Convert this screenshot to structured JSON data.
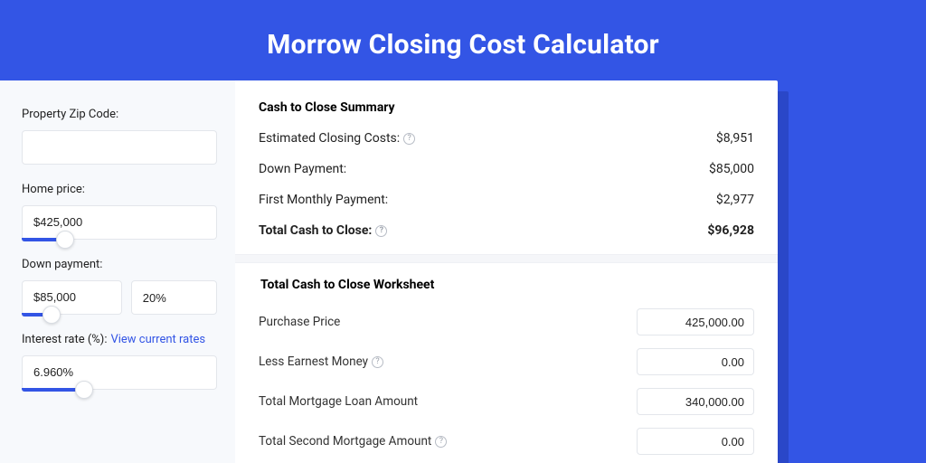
{
  "title": "Morrow Closing Cost Calculator",
  "left": {
    "zip": {
      "label": "Property Zip Code:",
      "value": ""
    },
    "home_price": {
      "label": "Home price:",
      "value": "$425,000",
      "slider_pct": 22
    },
    "down_payment": {
      "label": "Down payment:",
      "value": "$85,000",
      "pct_value": "20%",
      "slider_pct": 30
    },
    "interest": {
      "label": "Interest rate (%):",
      "link": "View current rates",
      "value": "6.960%",
      "slider_pct": 32
    }
  },
  "summary": {
    "title": "Cash to Close Summary",
    "rows": [
      {
        "label": "Estimated Closing Costs:",
        "help": true,
        "value": "$8,951"
      },
      {
        "label": "Down Payment:",
        "help": false,
        "value": "$85,000"
      },
      {
        "label": "First Monthly Payment:",
        "help": false,
        "value": "$2,977"
      }
    ],
    "total": {
      "label": "Total Cash to Close:",
      "help": true,
      "value": "$96,928"
    }
  },
  "worksheet": {
    "title": "Total Cash to Close Worksheet",
    "rows": [
      {
        "label": "Purchase Price",
        "help": false,
        "value": "425,000.00"
      },
      {
        "label": "Less Earnest Money",
        "help": true,
        "value": "0.00"
      },
      {
        "label": "Total Mortgage Loan Amount",
        "help": false,
        "value": "340,000.00"
      },
      {
        "label": "Total Second Mortgage Amount",
        "help": true,
        "value": "0.00"
      }
    ]
  }
}
